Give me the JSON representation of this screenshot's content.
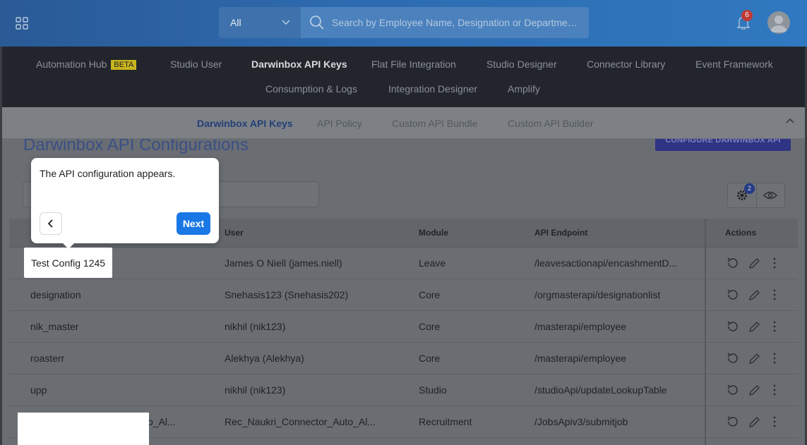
{
  "header": {
    "scope_select": "All",
    "search_placeholder": "Search by Employee Name, Designation or Department...",
    "notification_count": "6",
    "icons": [
      "apps-grid-icon",
      "chevron-down-icon",
      "search-icon",
      "bell-icon",
      "user-avatar"
    ]
  },
  "nav": {
    "items": [
      {
        "label": "Automation Hub",
        "badge": "BETA"
      },
      {
        "label": "Studio User"
      },
      {
        "label": "Darwinbox API Keys",
        "active": true
      },
      {
        "label": "Flat File Integration"
      },
      {
        "label": "Studio Designer"
      },
      {
        "label": "Connector Library"
      },
      {
        "label": "Event Framework"
      },
      {
        "label": "Consumption & Logs"
      },
      {
        "label": "Integration Designer"
      },
      {
        "label": "Amplify"
      }
    ]
  },
  "subnav": {
    "items": [
      {
        "label": "Darwinbox API Keys",
        "active": true
      },
      {
        "label": "API Policy"
      },
      {
        "label": "Custom API Bundle"
      },
      {
        "label": "Custom API Builder"
      }
    ]
  },
  "page": {
    "title": "Darwinbox API Configurations",
    "configure_button": "CONFIGURE DARWINBOX API",
    "settings_badge": "2"
  },
  "table": {
    "columns": [
      "User",
      "Module",
      "API Endpoint",
      "Actions"
    ],
    "rows": [
      {
        "name": "Test Config 1245",
        "user": "James O Niell (james.niell)",
        "module": "Leave",
        "endpoint": "/leavesactionapi/encashmentD..."
      },
      {
        "name": "designation",
        "user": "Snehasis123 (Snehasis202)",
        "module": "Core",
        "endpoint": "/orgmasterapi/designationlist"
      },
      {
        "name": "nik_master",
        "user": "nikhil (nik123)",
        "module": "Core",
        "endpoint": "/masterapi/employee"
      },
      {
        "name": "roasterr",
        "user": "Alekhya (Alekhya)",
        "module": "Core",
        "endpoint": "/masterapi/employee"
      },
      {
        "name": "upp",
        "user": "nikhil (nik123)",
        "module": "Studio",
        "endpoint": "/studioApi/updateLookupTable"
      },
      {
        "name": "o_Al...",
        "user": "Rec_Naukri_Connector_Auto_Al...",
        "module": "Recruitment",
        "endpoint": "/JobsApiv3/submitjob"
      }
    ]
  },
  "tooltip": {
    "text": "The API configuration appears.",
    "next_label": "Next"
  }
}
